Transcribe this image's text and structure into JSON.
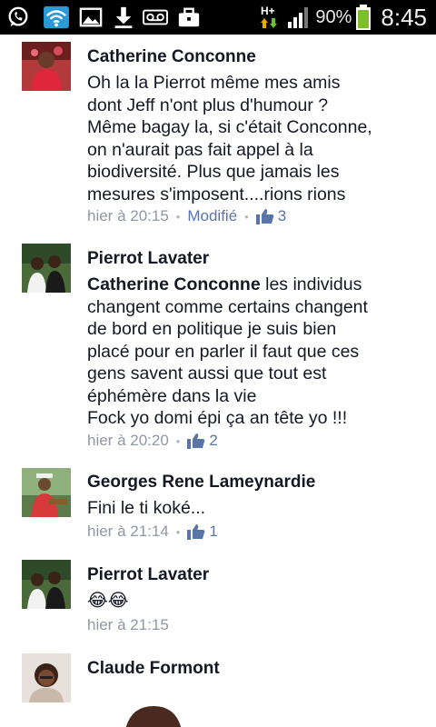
{
  "status_bar": {
    "network_label": "H+",
    "battery_percent": "90%",
    "time": "8:45",
    "icons": [
      "whatsapp-icon",
      "wifi-icon",
      "gallery-icon",
      "download-icon",
      "voicemail-icon",
      "briefcase-icon",
      "network-arrows-icon",
      "signal-icon",
      "battery-icon"
    ]
  },
  "comments": [
    {
      "author": "Catherine Conconne",
      "mention": "",
      "lines": [
        "Oh la la Pierrot  même mes amis",
        "dont Jeff  n'ont plus d'humour ?",
        "Même bagay la, si c'était Conconne,",
        "on n'aurait pas fait appel à la",
        "biodiversité. Plus  que jamais les",
        "mesures s'imposent....rions rions"
      ],
      "time": "hier à 20:15",
      "edited": "Modifié",
      "likes": "3"
    },
    {
      "author": "Pierrot Lavater",
      "mention": "Catherine Conconne",
      "first_line_rest": " les individus",
      "lines": [
        "changent comme certains changent",
        "de bord en politique je suis bien",
        "placé pour en parler il  faut que ces",
        "gens savent  aussi que tout est",
        "éphémère dans la vie",
        " Fock yo domi épi ça an tête yo !!!"
      ],
      "time": "hier à 20:20",
      "likes": "2"
    },
    {
      "author": "Georges Rene Lameynardie",
      "lines": [
        "Fini le ti koké..."
      ],
      "time": "hier à 21:14",
      "likes": "1"
    },
    {
      "author": "Pierrot Lavater",
      "lines": [
        "😂😂"
      ],
      "time": "hier à 21:15"
    },
    {
      "author": "Claude Formont",
      "lines": [],
      "time": ""
    }
  ]
}
